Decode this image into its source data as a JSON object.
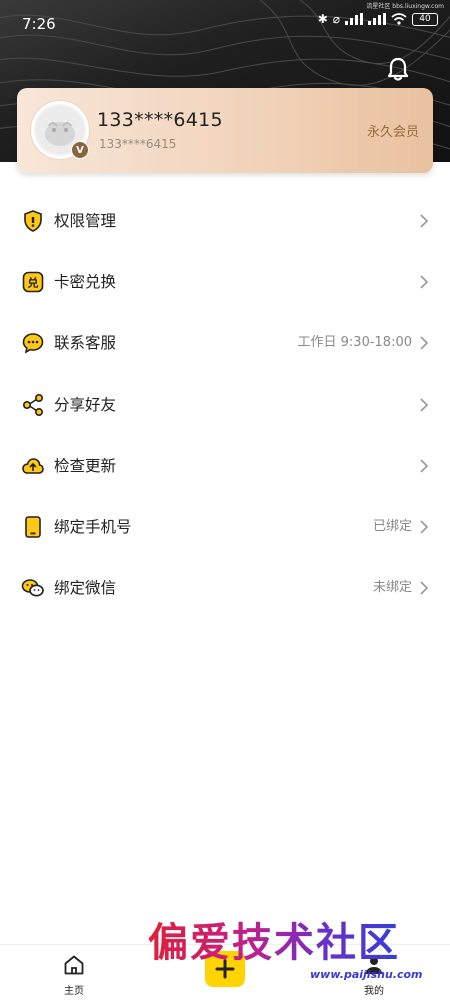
{
  "status_bar": {
    "time": "7:26",
    "battery": "40",
    "watermark": "流星社区 bbs.liuxingw.com"
  },
  "profile": {
    "name": "133****6415",
    "sub": "133****6415",
    "vip_label": "永久会员",
    "badge": "V"
  },
  "menu": [
    {
      "label": "权限管理",
      "value": "",
      "icon": "shield-icon"
    },
    {
      "label": "卡密兑换",
      "value": "",
      "icon": "redeem-icon"
    },
    {
      "label": "联系客服",
      "value": "工作日 9:30-18:00",
      "icon": "chat-icon"
    },
    {
      "label": "分享好友",
      "value": "",
      "icon": "share-icon"
    },
    {
      "label": "检查更新",
      "value": "",
      "icon": "cloud-upload-icon"
    },
    {
      "label": "绑定手机号",
      "value": "已绑定",
      "icon": "phone-icon"
    },
    {
      "label": "绑定微信",
      "value": "未绑定",
      "icon": "wechat-icon"
    }
  ],
  "tabbar": {
    "home": "主页",
    "mine": "我的"
  },
  "watermark": {
    "title": "偏爱技术社区",
    "url": "www.paijishu.com"
  },
  "colors": {
    "accent": "#ffd400",
    "vip_text": "#9b6a3a"
  }
}
